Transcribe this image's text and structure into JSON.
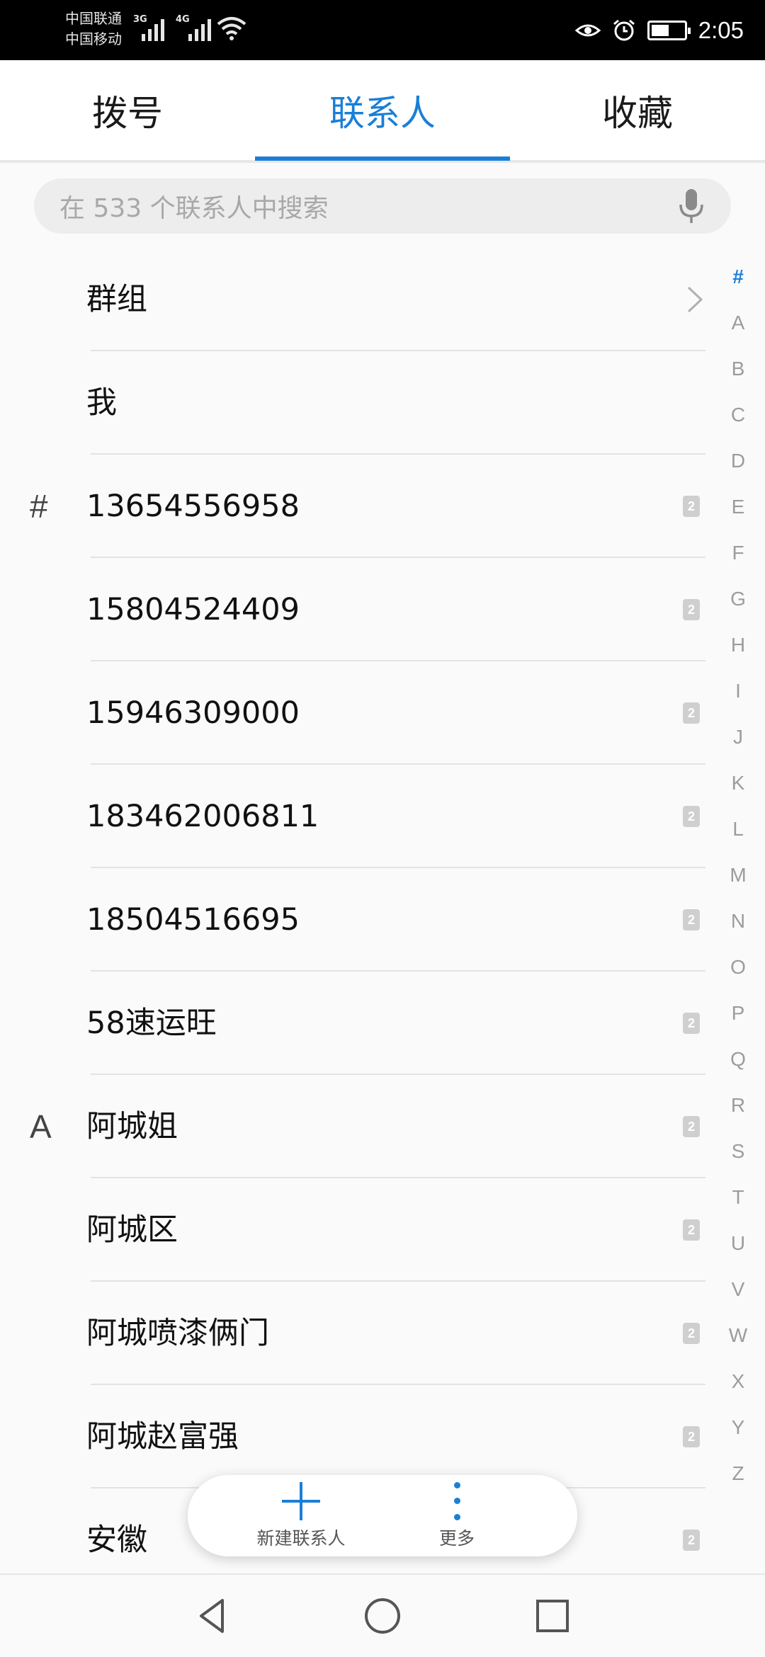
{
  "status_bar": {
    "carrier_1": "中国联通",
    "carrier_2": "中国移动",
    "signal_1_type": "3G",
    "signal_2_type": "4G",
    "time": "2:05",
    "battery_level": 0.55,
    "icons": [
      "eye-comfort-icon",
      "alarm-icon",
      "battery-icon",
      "wifi-icon",
      "signal-icon"
    ]
  },
  "tabs": [
    {
      "label": "拨号",
      "active": false
    },
    {
      "label": "联系人",
      "active": true
    },
    {
      "label": "收藏",
      "active": false
    }
  ],
  "search": {
    "placeholder": "在 533 个联系人中搜索",
    "icon": "microphone-icon"
  },
  "contacts": [
    {
      "section": "",
      "name": "群组",
      "trailing": "chevron"
    },
    {
      "section": "",
      "name": "我",
      "trailing": ""
    },
    {
      "section": "#",
      "name": "13654556958",
      "trailing": "sim"
    },
    {
      "section": "",
      "name": "15804524409",
      "trailing": "sim"
    },
    {
      "section": "",
      "name": "15946309000",
      "trailing": "sim"
    },
    {
      "section": "",
      "name": "183462006811",
      "trailing": "sim"
    },
    {
      "section": "",
      "name": "18504516695",
      "trailing": "sim"
    },
    {
      "section": "",
      "name": "58速运旺",
      "trailing": "sim"
    },
    {
      "section": "A",
      "name": "阿城姐",
      "trailing": "sim"
    },
    {
      "section": "",
      "name": "阿城区",
      "trailing": "sim"
    },
    {
      "section": "",
      "name": "阿城喷漆俩门",
      "trailing": "sim"
    },
    {
      "section": "",
      "name": "阿城赵富强",
      "trailing": "sim"
    },
    {
      "section": "",
      "name": "安徽",
      "trailing": "sim"
    }
  ],
  "sim_badge": "2",
  "alphabet_index": [
    "#",
    "A",
    "B",
    "C",
    "D",
    "E",
    "F",
    "G",
    "H",
    "I",
    "J",
    "K",
    "L",
    "M",
    "N",
    "O",
    "P",
    "Q",
    "R",
    "S",
    "T",
    "U",
    "V",
    "W",
    "X",
    "Y",
    "Z"
  ],
  "alphabet_active": "#",
  "actions": {
    "new_contact_label": "新建联系人",
    "more_label": "更多"
  },
  "colors": {
    "accent": "#1a7fd6",
    "background": "#fafafa",
    "status_bar": "#000000"
  }
}
